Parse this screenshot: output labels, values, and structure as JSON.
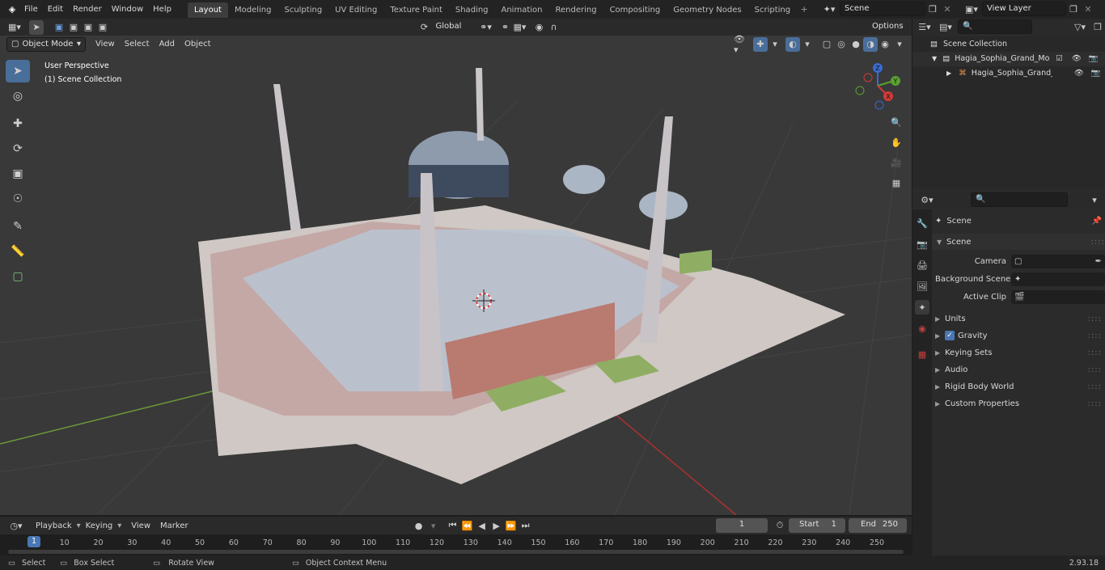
{
  "topbar": {
    "menus": [
      "File",
      "Edit",
      "Render",
      "Window",
      "Help"
    ],
    "workspaces": [
      "Layout",
      "Modeling",
      "Sculpting",
      "UV Editing",
      "Texture Paint",
      "Shading",
      "Animation",
      "Rendering",
      "Compositing",
      "Geometry Nodes",
      "Scripting"
    ],
    "active_workspace": "Layout",
    "scene": "Scene",
    "view_layer": "View Layer"
  },
  "viewport_header": {
    "mode": "Object Mode",
    "menus": [
      "View",
      "Select",
      "Add",
      "Object"
    ],
    "transform_orientation": "Global",
    "options": "Options"
  },
  "viewport": {
    "perspective": "User Perspective",
    "collection": "(1) Scene Collection",
    "gizmo_axes": [
      "Z",
      "Y",
      "X"
    ]
  },
  "outliner": {
    "root": "Scene Collection",
    "items": [
      {
        "name": "Hagia_Sophia_Grand_Mosque"
      },
      {
        "name": "Hagia_Sophia_Grand_Mo:"
      }
    ]
  },
  "properties": {
    "context": "Scene",
    "section": "Scene",
    "fields": [
      {
        "label": "Camera",
        "value": ""
      },
      {
        "label": "Background Scene",
        "value": ""
      },
      {
        "label": "Active Clip",
        "value": ""
      }
    ],
    "panels": [
      "Units",
      "Gravity",
      "Keying Sets",
      "Audio",
      "Rigid Body World",
      "Custom Properties"
    ],
    "gravity_checked": true
  },
  "timeline": {
    "menus": [
      "Playback",
      "Keying",
      "View",
      "Marker"
    ],
    "current_frame": "1",
    "start_label": "Start",
    "start": "1",
    "end_label": "End",
    "end": "250",
    "ticks": [
      "1",
      "10",
      "20",
      "30",
      "40",
      "50",
      "60",
      "70",
      "80",
      "90",
      "100",
      "110",
      "120",
      "130",
      "140",
      "150",
      "160",
      "170",
      "180",
      "190",
      "200",
      "210",
      "220",
      "230",
      "240",
      "250"
    ]
  },
  "statusbar": {
    "select": "Select",
    "box_select": "Box Select",
    "rotate": "Rotate View",
    "context_menu": "Object Context Menu",
    "version": "2.93.18"
  },
  "colors": {
    "accent": "#4a6e9a",
    "background": "#393939",
    "panel": "#2b2b2b"
  }
}
